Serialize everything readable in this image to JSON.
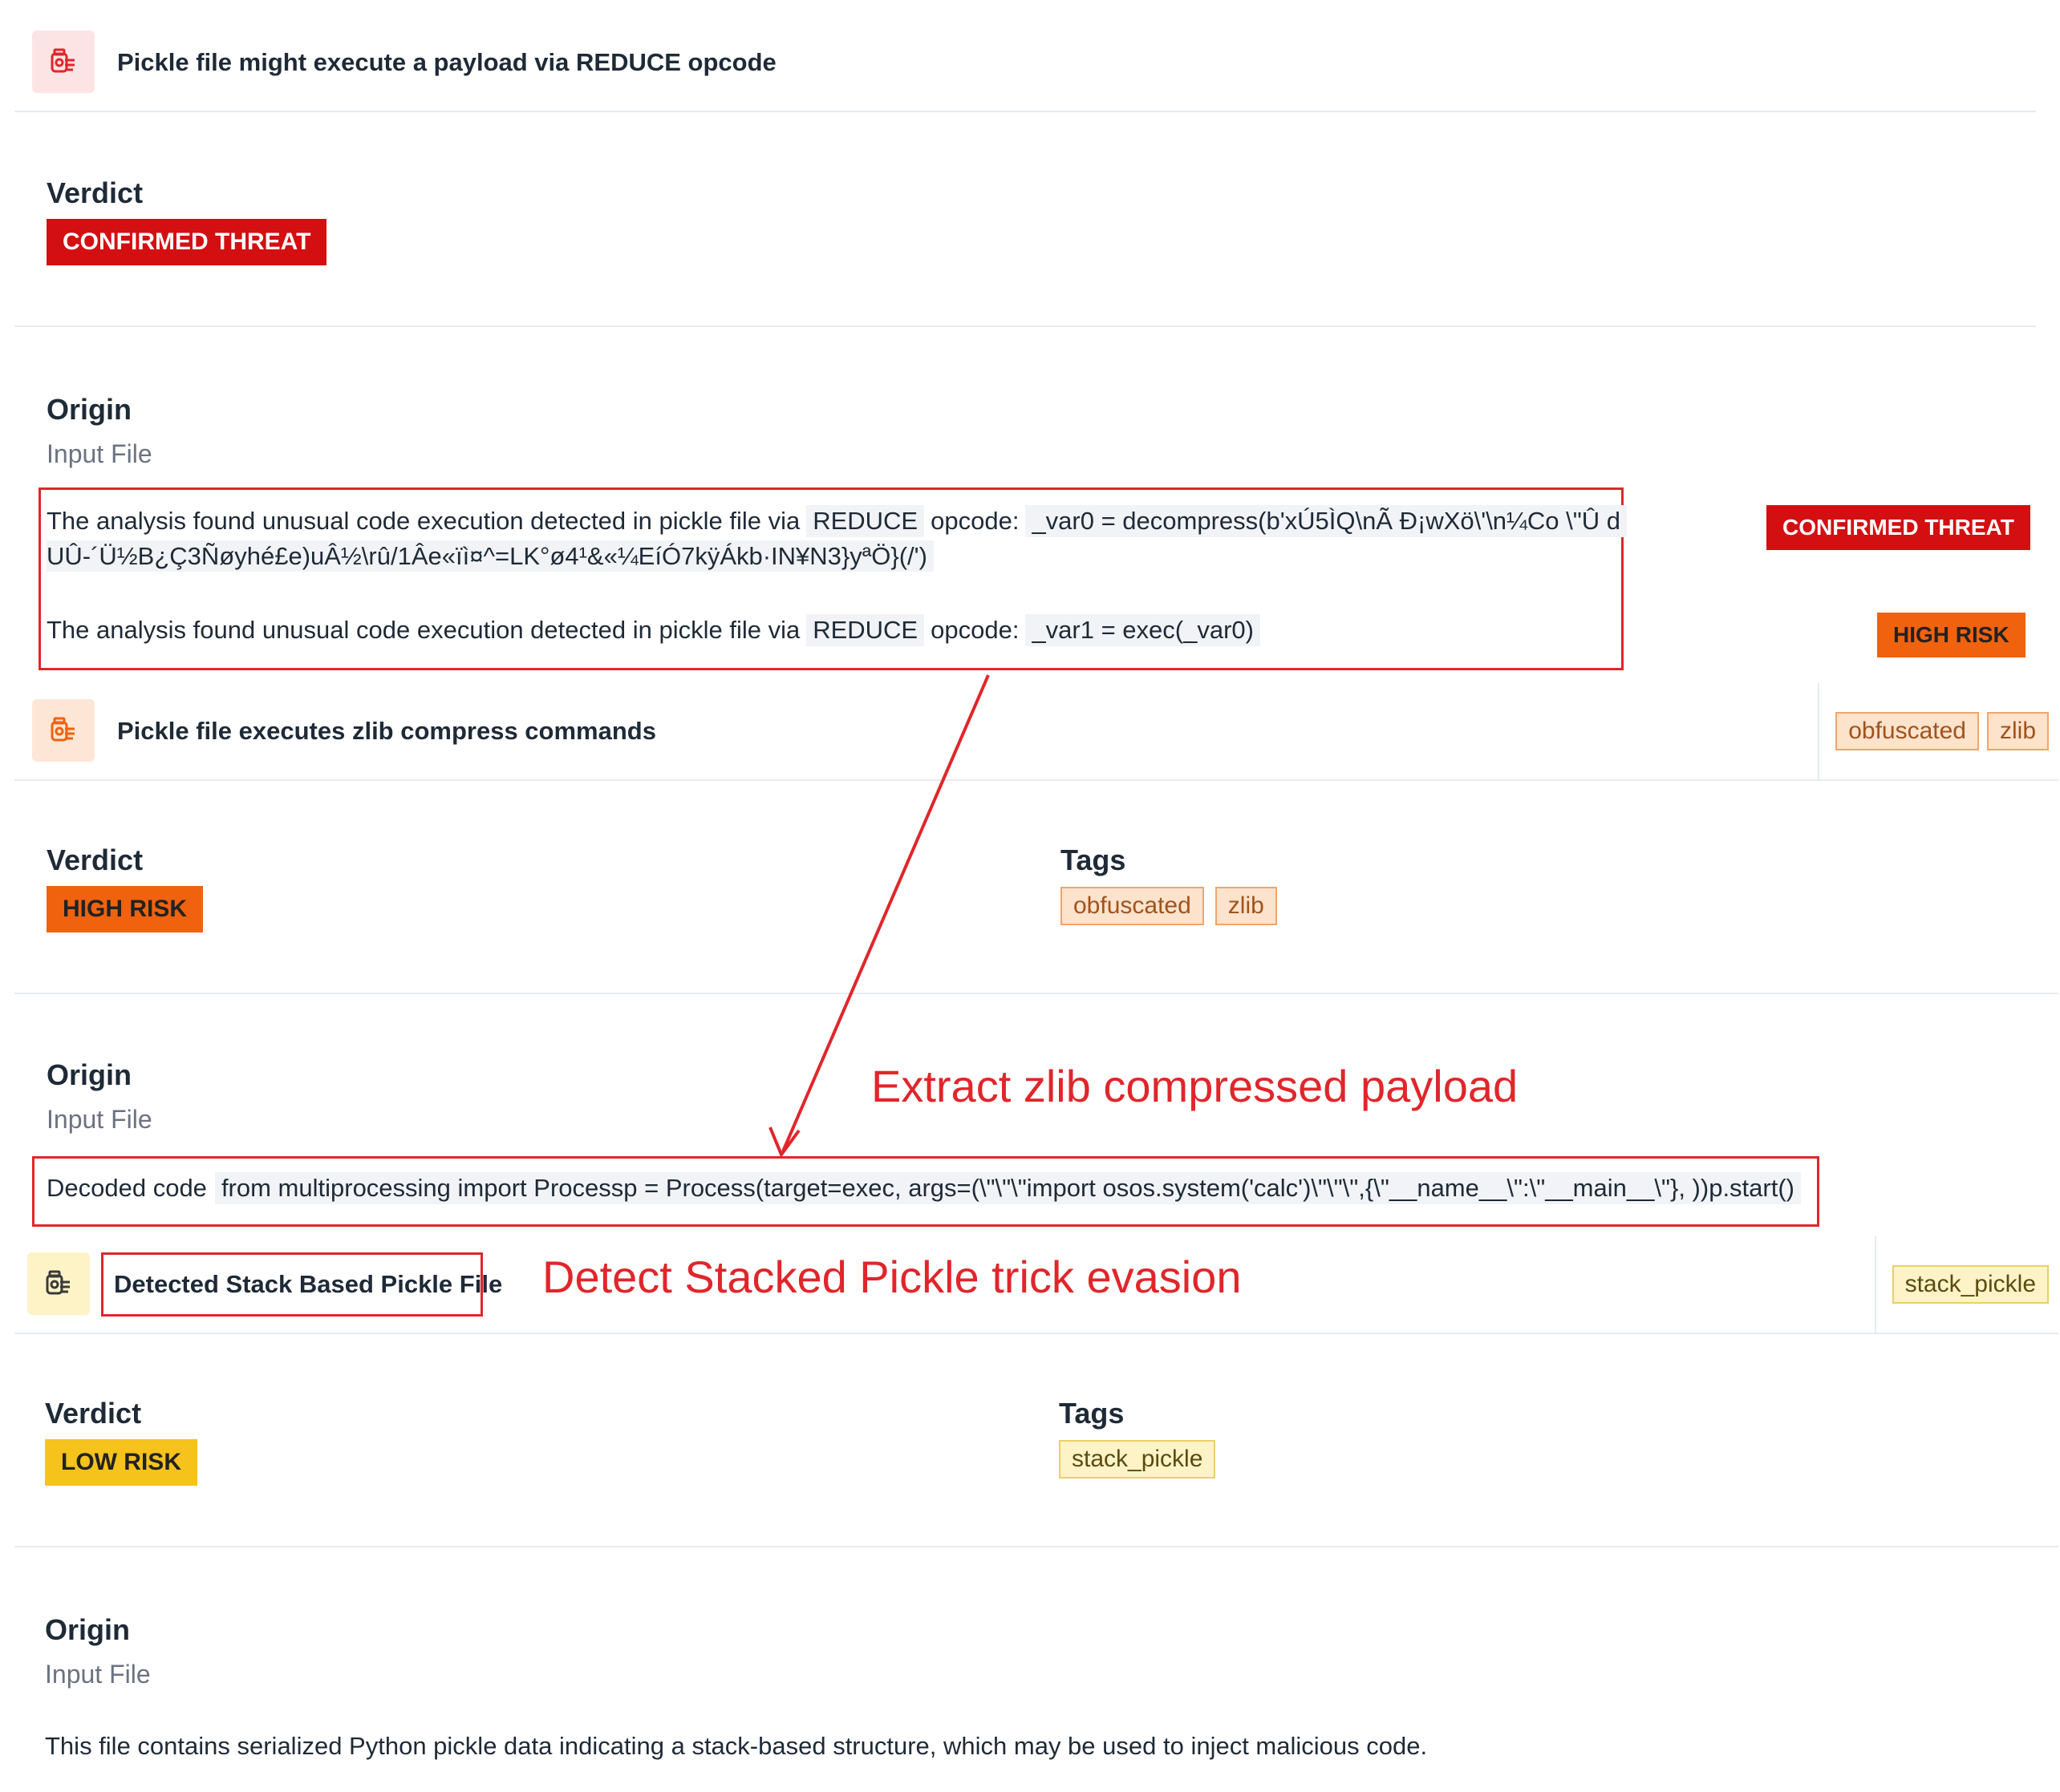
{
  "section1": {
    "title": "Pickle file might execute a payload via REDUCE opcode",
    "verdict_label": "Verdict",
    "verdict_badge": "CONFIRMED THREAT",
    "origin_label": "Origin",
    "origin_value": "Input File",
    "finding1_prefix": "The analysis found unusual code execution detected in pickle file via",
    "finding1_opcode": "REDUCE",
    "finding1_mid": "opcode:",
    "finding1_code_line1": "_var0 = decompress(b'xÚ5ÌQ\\nÃ Đ¡wXö\\'\\n¼Co \\\"Û d",
    "finding1_code_line2": "UÛ-´Ü½B¿Ç3Ñøyhé£e)uÂ½\\rû/1Âe«ïì¤^=LK°ø4¹&«¼EíÓ7kÿÁkb·IN¥N3}yªÖ}(/')",
    "finding1_badge": "CONFIRMED THREAT",
    "finding2_prefix": "The analysis found unusual code execution detected in pickle file via",
    "finding2_opcode": "REDUCE",
    "finding2_mid": "opcode:",
    "finding2_code": "_var1 = exec(_var0)",
    "finding2_badge": "HIGH RISK"
  },
  "section2": {
    "title": "Pickle file executes zlib compress commands",
    "head_tags": [
      "obfuscated",
      "zlib"
    ],
    "verdict_label": "Verdict",
    "verdict_badge": "HIGH RISK",
    "tags_label": "Tags",
    "tags": [
      "obfuscated",
      "zlib"
    ],
    "origin_label": "Origin",
    "origin_value": "Input File",
    "decoded_label": "Decoded code",
    "decoded_value": "from multiprocessing import Processp = Process(target=exec, args=(\\\"\\\"\\\"import osos.system('calc')\\\"\\\"\\\",{\\\"__name__\\\":\\\"__main__\\\"}, ))p.start()"
  },
  "section3": {
    "title": "Detected Stack Based Pickle File",
    "head_tags": [
      "stack_pickle"
    ],
    "verdict_label": "Verdict",
    "verdict_badge": "LOW RISK",
    "tags_label": "Tags",
    "tags": [
      "stack_pickle"
    ],
    "origin_label": "Origin",
    "origin_value": "Input File",
    "description": "This file contains serialized Python pickle data indicating a stack-based structure, which may be used to inject malicious code."
  },
  "annotations": {
    "zlib": "Extract zlib compressed payload",
    "stacked": "Detect Stacked Pickle trick evasion"
  },
  "colors": {
    "confirmed": "#d40f12",
    "high": "#f0620e",
    "low": "#f6c21c",
    "annotation": "#e0262b"
  },
  "icons": {
    "section1": "pickle-jar-icon",
    "section2": "pickle-jar-icon",
    "section3": "pickle-jar-icon"
  }
}
